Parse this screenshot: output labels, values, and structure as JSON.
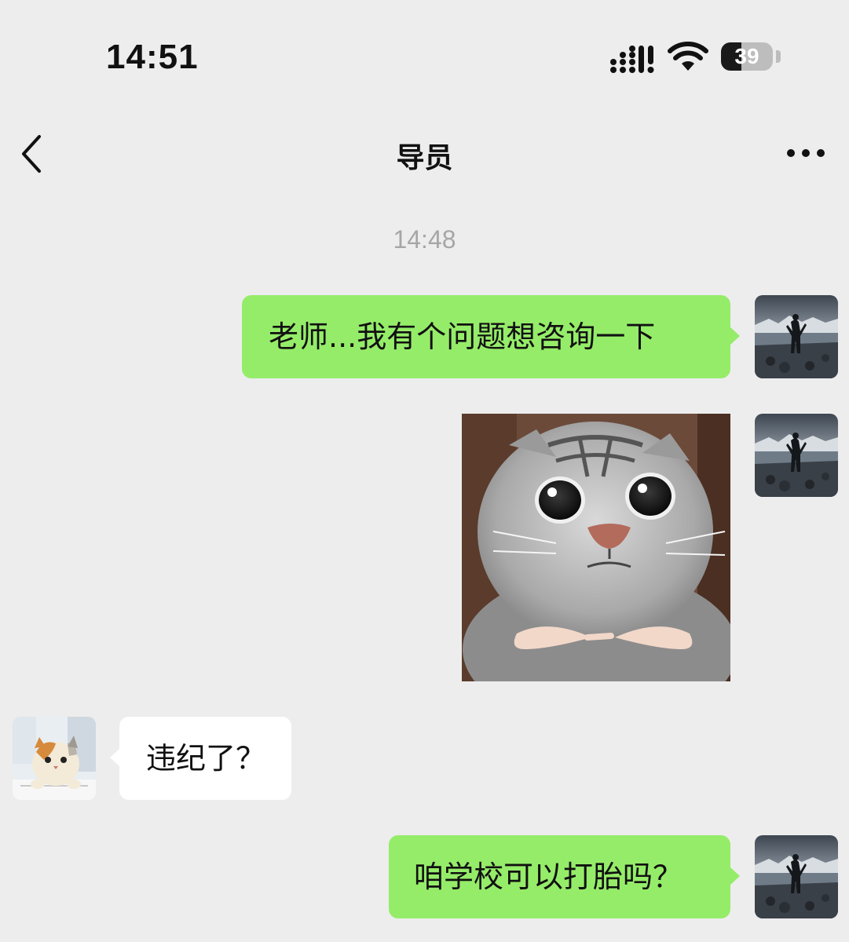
{
  "status_bar": {
    "time": "14:51",
    "battery_level": "39",
    "icons": [
      "cellular-signal-icon",
      "wifi-icon",
      "battery-icon"
    ]
  },
  "nav": {
    "title": "导员",
    "back_icon": "chevron-left-icon",
    "more_icon": "ellipsis-icon"
  },
  "chat": {
    "timestamp": "14:48",
    "messages": [
      {
        "sender": "me",
        "type": "text",
        "text": "老师...我有个问题想咨询一下"
      },
      {
        "sender": "me",
        "type": "sticker",
        "sticker": "crying cat pointing fingers sticker"
      },
      {
        "sender": "other",
        "type": "text",
        "text": "违纪了？"
      },
      {
        "sender": "me",
        "type": "text",
        "text": "咱学校可以打胎吗？"
      }
    ]
  },
  "colors": {
    "background": "#ededed",
    "my_bubble": "#95ec69",
    "other_bubble": "#ffffff",
    "timestamp": "#a6a6a6"
  }
}
